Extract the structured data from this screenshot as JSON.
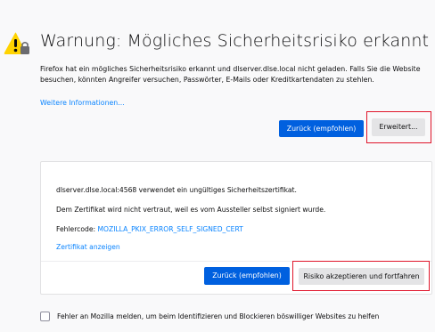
{
  "page": {
    "title": "Warnung: Mögliches Sicherheitsrisiko erkannt",
    "intro": "Firefox hat ein mögliches Sicherheitsrisiko erkannt und dlserver.dlse.local nicht geladen. Falls Sie die Website besuchen, könnten Angreifer versuchen, Passwörter, E-Mails oder Kreditkartendaten zu stehlen.",
    "more_info_link": "Weitere Informationen...",
    "warning_icon": "warning-triangle-with-lock-icon",
    "colors": {
      "primary_button": "#0060df",
      "link": "#0a84ff",
      "highlight": "#e0152a",
      "warning": "#ffd300"
    }
  },
  "actions": {
    "back_label": "Zurück (empfohlen)",
    "advanced_label": "Erweitert..."
  },
  "advanced_panel": {
    "cert_message": "dlserver.dlse.local:4568 verwendet ein ungültiges Sicherheitszertifikat.",
    "trust_message": "Dem Zertifikat wird nicht vertraut, weil es vom Aussteller selbst signiert wurde.",
    "error_code_label": "Fehlercode: ",
    "error_code": "MOZILLA_PKIX_ERROR_SELF_SIGNED_CERT",
    "view_cert_link": "Zertifikat anzeigen",
    "back_label": "Zurück (empfohlen)",
    "accept_label": "Risiko akzeptieren und fortfahren"
  },
  "report": {
    "label": "Fehler an Mozilla melden, um beim Identifizieren und Blockieren böswilliger Websites zu helfen",
    "checked": false
  }
}
